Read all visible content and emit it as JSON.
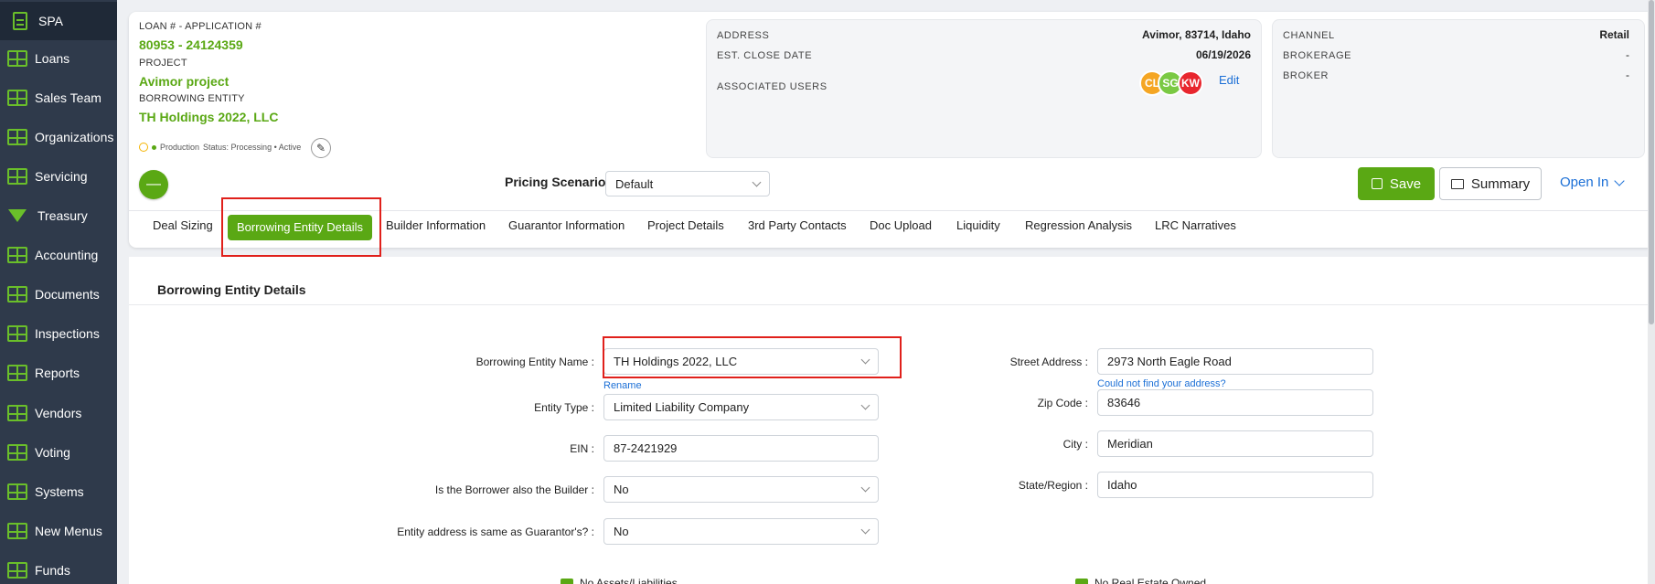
{
  "sidebar": {
    "items": [
      {
        "label": "SPA",
        "icon": "document-icon"
      },
      {
        "label": "Loans",
        "icon": "grid-icon"
      },
      {
        "label": "Sales Team",
        "icon": "grid-icon"
      },
      {
        "label": "Organizations",
        "icon": "grid-icon"
      },
      {
        "label": "Servicing",
        "icon": "grid-icon"
      },
      {
        "label": "Treasury",
        "icon": "gem-icon"
      },
      {
        "label": "Accounting",
        "icon": "grid-icon"
      },
      {
        "label": "Documents",
        "icon": "grid-icon"
      },
      {
        "label": "Inspections",
        "icon": "grid-icon"
      },
      {
        "label": "Reports",
        "icon": "grid-icon"
      },
      {
        "label": "Vendors",
        "icon": "grid-icon"
      },
      {
        "label": "Voting",
        "icon": "grid-icon"
      },
      {
        "label": "Systems",
        "icon": "grid-icon"
      },
      {
        "label": "New Menus",
        "icon": "grid-icon"
      },
      {
        "label": "Funds",
        "icon": "grid-icon"
      }
    ]
  },
  "loan": {
    "loan_label": "LOAN # - APPLICATION #",
    "loan_value": "80953 - 24124359",
    "project_label": "PROJECT",
    "project_value": "Avimor project",
    "entity_label": "BORROWING ENTITY",
    "entity_value": "TH Holdings 2022, LLC",
    "status_env": "Production",
    "status_text": "Status: Processing • Active"
  },
  "address_box": {
    "address_label": "ADDRESS",
    "address_value": "Avimor, 83714, Idaho",
    "close_label": "EST. CLOSE DATE",
    "close_value": "06/19/2026",
    "users_label": "ASSOCIATED USERS",
    "users": [
      {
        "initials": "CL",
        "color": "#f5a623"
      },
      {
        "initials": "SG",
        "color": "#7ac943"
      },
      {
        "initials": "KW",
        "color": "#e8262e"
      }
    ],
    "edit_label": "Edit"
  },
  "channel_box": {
    "channel_label": "CHANNEL",
    "channel_value": "Retail",
    "brokerage_label": "BROKERAGE",
    "brokerage_value": "-",
    "broker_label": "BROKER",
    "broker_value": "-"
  },
  "toolbar": {
    "minus": "—",
    "pricing_label": "Pricing Scenario:",
    "pricing_value": "Default",
    "save_label": "Save",
    "summary_label": "Summary",
    "open_in_label": "Open In"
  },
  "tabs": [
    {
      "label": "Deal Sizing"
    },
    {
      "label": "Borrowing Entity Details",
      "active": true
    },
    {
      "label": "Builder Information"
    },
    {
      "label": "Guarantor Information"
    },
    {
      "label": "Project Details"
    },
    {
      "label": "3rd Party Contacts"
    },
    {
      "label": "Doc Upload"
    },
    {
      "label": "Liquidity"
    },
    {
      "label": "Regression Analysis"
    },
    {
      "label": "LRC Narratives"
    }
  ],
  "form": {
    "section_title": "Borrowing Entity Details",
    "entity_name_label": "Borrowing Entity Name",
    "entity_name_value": "TH Holdings 2022, LLC",
    "rename_label": "Rename",
    "entity_type_label": "Entity Type",
    "entity_type_value": "Limited Liability Company",
    "ein_label": "EIN",
    "ein_value": "87-2421929",
    "builder_label": "Is the Borrower also the Builder",
    "builder_value": "No",
    "guarantor_addr_label": "Entity address is same as Guarantor's?",
    "guarantor_addr_value": "No",
    "street_label": "Street Address",
    "street_value": "2973 North Eagle Road",
    "not_find_label": "Could not find your address?",
    "zip_label": "Zip Code",
    "zip_value": "83646",
    "city_label": "City",
    "city_value": "Meridian",
    "state_label": "State/Region",
    "state_value": "Idaho",
    "no_assets_label": "No Assets/Liabilities",
    "no_real_estate_label": "No Real Estate Owned",
    "colon": ":"
  },
  "colors": {
    "accent_green": "#5aa814",
    "link_blue": "#1b6fd6",
    "highlight_red": "#e0201b",
    "sidebar_bg": "#2f3a4b"
  }
}
